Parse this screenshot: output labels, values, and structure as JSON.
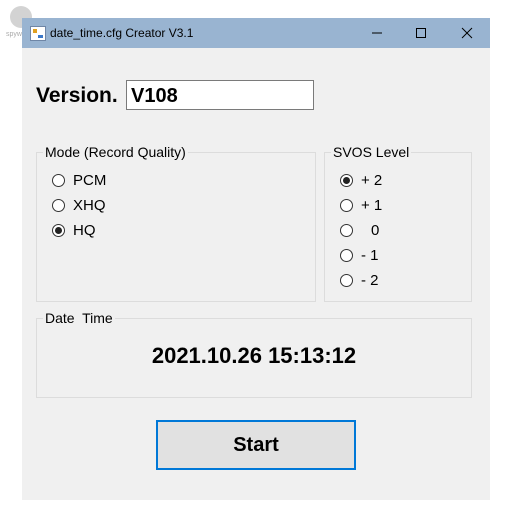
{
  "window": {
    "title": "date_time.cfg Creator V3.1"
  },
  "watermark": {
    "text": "spyw..."
  },
  "version": {
    "label": "Version.",
    "value": "V108"
  },
  "mode_group": {
    "title": "Mode (Record Quality)",
    "options": [
      {
        "label": "PCM",
        "selected": false
      },
      {
        "label": "XHQ",
        "selected": false
      },
      {
        "label": "HQ",
        "selected": true
      }
    ]
  },
  "svos_group": {
    "title": "SVOS Level",
    "options": [
      {
        "label": "+ 2",
        "selected": true
      },
      {
        "label": "+ 1",
        "selected": false
      },
      {
        "label": "0",
        "selected": false
      },
      {
        "label": "- 1",
        "selected": false
      },
      {
        "label": "- 2",
        "selected": false
      }
    ]
  },
  "datetime_group": {
    "title": "Date  Time",
    "value": "2021.10.26 15:13:12"
  },
  "start_button": {
    "label": "Start"
  }
}
